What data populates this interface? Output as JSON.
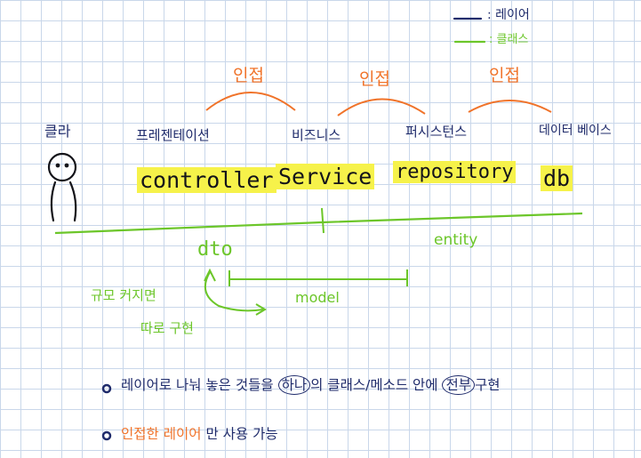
{
  "legend": {
    "layer": ": 레이어",
    "class": ": 클래스"
  },
  "injection_label": "인접",
  "actor_label": "클라",
  "layers": [
    {
      "name": "프레젠테이션",
      "component": "controller"
    },
    {
      "name": "비즈니스",
      "component": "Service"
    },
    {
      "name": "퍼시스턴스",
      "component": "repository"
    },
    {
      "name": "데이터 베이스",
      "component": "db"
    }
  ],
  "classes": {
    "dto": "dto",
    "entity": "entity",
    "model": "model"
  },
  "side_note": {
    "line1": "규모 커지면",
    "line2": "따로 구현"
  },
  "bullets": {
    "b1_pre": "레이어로 나눠 놓은 것들을",
    "b1_circle1": "하나",
    "b1_mid": "의 클래스/메소드 안에",
    "b1_circle2": "전부",
    "b1_post": "구현",
    "b2_orange": "인접한",
    "b2_mid": "레이어",
    "b2_post": "만 사용 가능"
  },
  "colors": {
    "layer_ink": "#1f2b6b",
    "class_ink": "#6cc62a",
    "injection_ink": "#f0732a",
    "highlight": "#f6f24a"
  }
}
